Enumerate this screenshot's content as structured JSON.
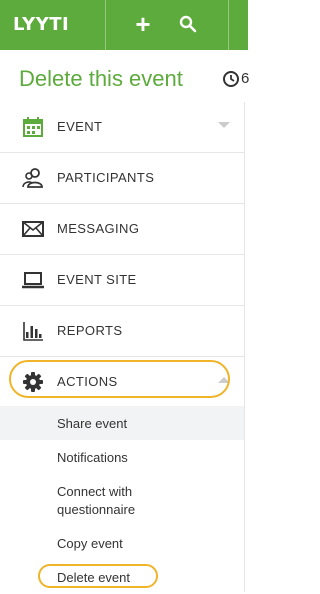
{
  "brand": {
    "logo": "LYYTI",
    "bar_color": "#5cab3c",
    "highlight_color": "#f0b429"
  },
  "header": {
    "title": "Delete this event",
    "clock_value": "6"
  },
  "nav": {
    "items": [
      {
        "label": "EVENT",
        "icon": "calendar-icon"
      },
      {
        "label": "PARTICIPANTS",
        "icon": "participants-icon"
      },
      {
        "label": "MESSAGING",
        "icon": "envelope-icon"
      },
      {
        "label": "EVENT SITE",
        "icon": "laptop-icon"
      },
      {
        "label": "REPORTS",
        "icon": "bar-chart-icon"
      },
      {
        "label": "ACTIONS",
        "icon": "gear-icon"
      }
    ],
    "actions": [
      {
        "label": "Share event"
      },
      {
        "label": "Notifications"
      },
      {
        "label": "Connect with",
        "label2": "questionnaire"
      },
      {
        "label": "Copy event"
      },
      {
        "label": "Delete event"
      }
    ]
  }
}
